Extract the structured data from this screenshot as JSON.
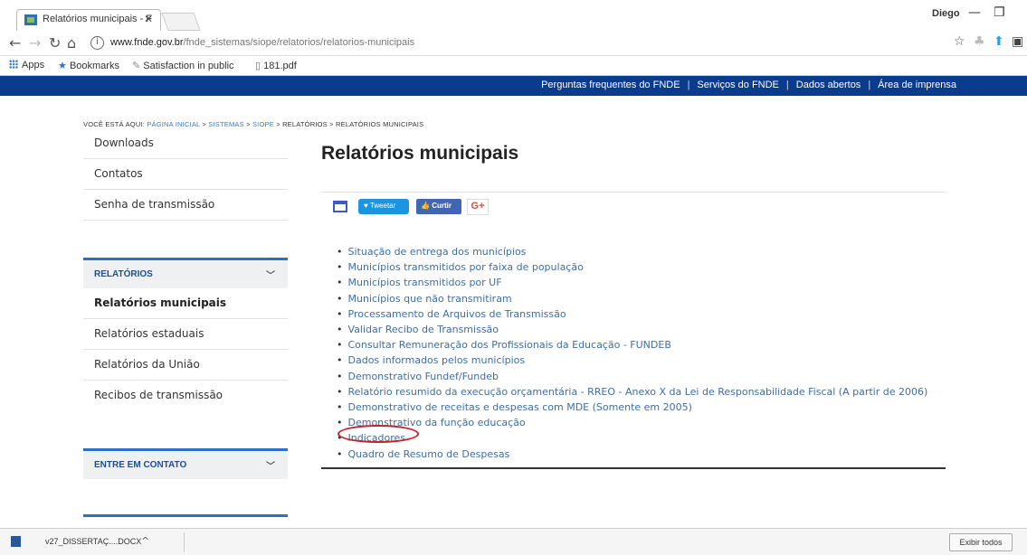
{
  "browser": {
    "tab_title": "Relatórios municipais - F",
    "user": "Diego",
    "url_host": "www.fnde.gov.br",
    "url_path": "/fnde_sistemas/siope/relatorios/relatorios-municipais",
    "bookmarks": [
      "Apps",
      "Bookmarks",
      "Satisfaction in public",
      "181.pdf"
    ]
  },
  "topbar": {
    "links": [
      "Perguntas frequentes do FNDE",
      "Serviços do FNDE",
      "Dados abertos",
      "Área de imprensa"
    ]
  },
  "breadcrumb": {
    "prefix": "VOCÊ ESTÁ AQUI:",
    "items": [
      "PÁGINA INICIAL",
      "SISTEMAS",
      "SIOPE",
      "RELATÓRIOS",
      "RELATÓRIOS MUNICIPAIS"
    ]
  },
  "sidebar": {
    "links": [
      "Downloads",
      "Contatos",
      "Senha de transmissão"
    ],
    "section1": {
      "title": "RELATÓRIOS",
      "items": [
        "Relatórios municipais",
        "Relatórios estaduais",
        "Relatórios da União",
        "Recibos de transmissão"
      ]
    },
    "section2": {
      "title": "ENTRE EM CONTATO"
    }
  },
  "main": {
    "title": "Relatórios municipais",
    "share": {
      "tweet": "Tweetar",
      "like": "Curtir",
      "gplus": "G+"
    },
    "reports": [
      "Situação de entrega dos municípios",
      "Municípios transmitidos por faixa de população",
      "Municípios transmitidos por UF",
      "Municípios que não transmitiram",
      "Processamento de Arquivos de Transmissão",
      "Validar Recibo de Transmissão",
      "Consultar Remuneração dos Profissionais da Educação - FUNDEB",
      "Dados informados pelos municípios",
      "Demonstrativo Fundef/Fundeb",
      "Relatório resumido da execução orçamentária - RREO - Anexo X da Lei de Responsabilidade Fiscal (A partir de 2006)",
      "Demonstrativo de receitas e despesas com MDE (Somente em 2005)",
      "Demonstrativo da função educação",
      "Indicadores",
      "Quadro de Resumo de Despesas"
    ]
  },
  "downloads": {
    "file": "v27_DISSERTAÇ....DOCX",
    "show_all": "Exibir todos"
  }
}
